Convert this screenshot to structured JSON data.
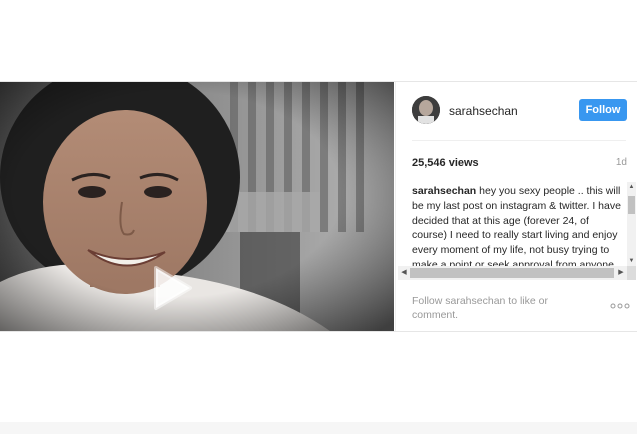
{
  "post": {
    "username": "sarahsechan",
    "follow_label": "Follow",
    "views": "25,546 views",
    "time": "1d",
    "caption_user": "sarahsechan",
    "caption": " hey you sexy people .. this will be my last post on instagram & twitter. I have decided that at this age (forever 24, of course) I need to really start living and enjoy every moment of my life, not busy trying to make a point or seek approval from anyone",
    "follow_prompt": "Follow sarahsechan to like or comment."
  },
  "icons": {
    "play": "play-icon",
    "more": "more-options-icon"
  },
  "colors": {
    "follow_button": "#3897f0",
    "muted_text": "#999999"
  }
}
